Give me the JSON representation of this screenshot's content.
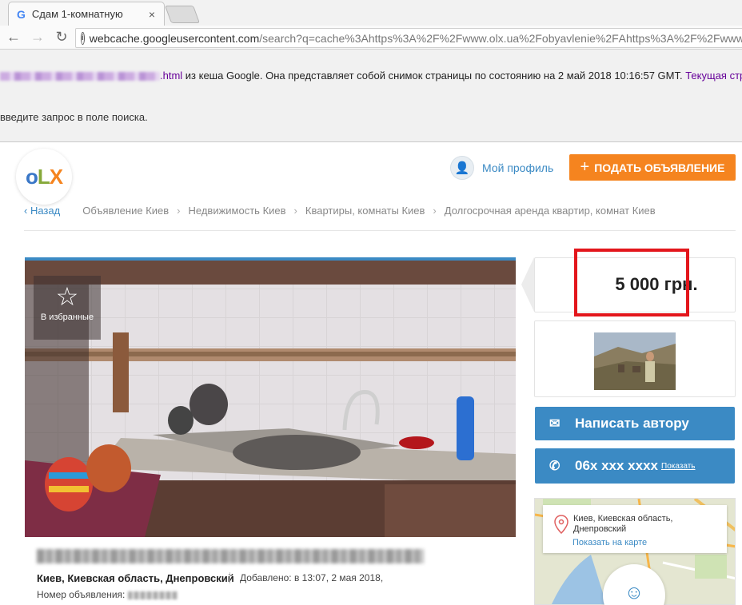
{
  "browser": {
    "tab_title": "Сдам 1-комнатную",
    "tab_close": "×",
    "url": "webcache.googleusercontent.com",
    "url_rest": "/search?q=cache%3Ahttps%3A%2F%2Fwww.olx.ua%2Fobyavlenie%2F",
    "url_tail": "Ahttps%3A%2F%2Fwww.o"
  },
  "cache": {
    "link_suffix": ".html",
    "info_text": " из кеша Google. Она представляет собой снимок страницы по состоянию на 2 май 2018 10:16:57 GMT. ",
    "current_link": "Текущая стр",
    "search_hint": "введите запрос в поле поиска."
  },
  "header": {
    "logo_o": "o",
    "logo_l": "L",
    "logo_x": "X",
    "profile_label": "Мой профиль",
    "post_button": "ПОДАТЬ ОБЪЯВЛЕНИЕ",
    "post_plus": "+"
  },
  "breadcrumbs": {
    "back": "Назад",
    "items": [
      "Объявление Киев",
      "Недвижимость Киев",
      "Квартиры, комнаты Киев",
      "Долгосрочная аренда квартир, комнат Киев"
    ]
  },
  "photo": {
    "favorite_label": "В избранные"
  },
  "ad": {
    "location": "Киев, Киевская область, Днепровский",
    "added": "Добавлено: в 13:07, 2 мая 2018,",
    "number_label": "Номер объявления: "
  },
  "sidebar": {
    "price": "5 000 грн.",
    "write_author": "Написать автору",
    "phone": "06х ххх хххх",
    "show_phone": "Показать",
    "map_address": "Киев, Киевская область, Днепровский",
    "map_address_line1": "Киев, Киевская область,",
    "map_address_line2": "Днепровский",
    "show_on_map": "Показать на карте"
  },
  "colors": {
    "olx_blue": "#3b8ac4",
    "olx_orange": "#f5841f",
    "highlight_red": "#e3161c"
  }
}
